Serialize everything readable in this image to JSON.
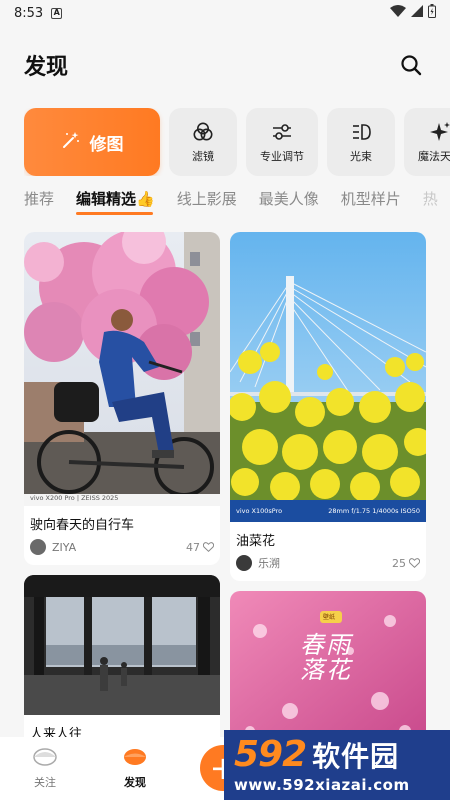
{
  "status_bar": {
    "time": "8:53",
    "notification_letter": "A"
  },
  "header": {
    "title": "发现"
  },
  "tools": {
    "primary": {
      "label": "修图",
      "icon": "magic-wand-icon"
    },
    "items": [
      {
        "label": "滤镜",
        "icon": "filter-circles-icon"
      },
      {
        "label": "专业调节",
        "icon": "sliders-icon"
      },
      {
        "label": "光束",
        "icon": "light-beam-icon"
      },
      {
        "label": "魔法天空",
        "icon": "sparkle-icon"
      }
    ]
  },
  "tabs": [
    {
      "label": "推荐"
    },
    {
      "label": "编辑精选👍"
    },
    {
      "label": "线上影展"
    },
    {
      "label": "最美人像"
    },
    {
      "label": "机型样片"
    },
    {
      "label": "热"
    }
  ],
  "feed": {
    "left": [
      {
        "title": "驶向春天的自行车",
        "author": "ZIYA",
        "likes": "47",
        "caption": "vivo X200 Pro | ZEISS 2025"
      },
      {
        "title": "人来人往",
        "author": "",
        "likes": ""
      }
    ],
    "right": [
      {
        "title": "油菜花",
        "author": "乐溯",
        "likes": "25",
        "caption_left": "vivo X100sPro",
        "caption_right": "28mm f/1.75 1/4000s ISO50"
      },
      {
        "title": "",
        "author": "",
        "likes": "",
        "overlay_text": "春雨落花",
        "badge": "壁纸"
      }
    ]
  },
  "bottom_nav": {
    "follow_label": "关注",
    "discover_label": "发现",
    "add_symbol": "+"
  },
  "watermark": {
    "number": "592",
    "name": "软件园",
    "url": "www.592xiazai.com"
  },
  "colors": {
    "accent": "#ff7a22",
    "background": "#f6f6f6"
  }
}
